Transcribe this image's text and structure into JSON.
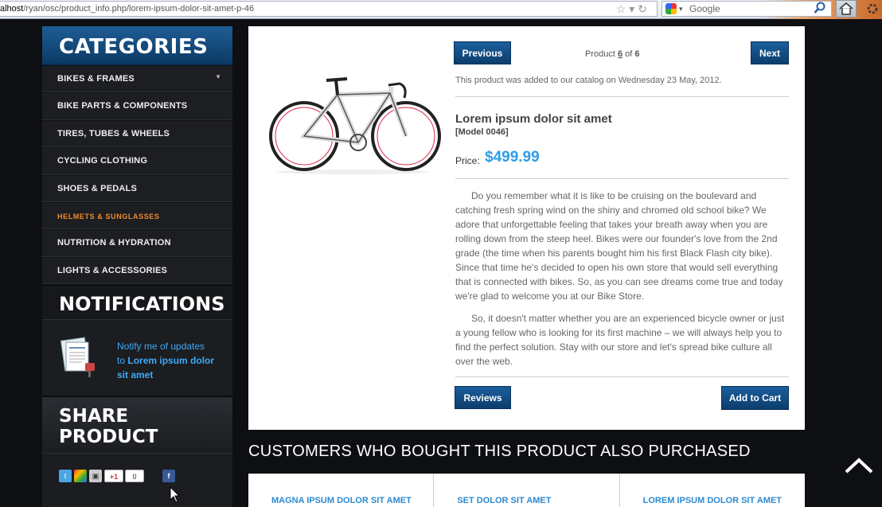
{
  "browser": {
    "url_host": "alhost",
    "url_path": "/ryan/osc/product_info.php/lorem-ipsum-dolor-sit-amet-p-46",
    "search_placeholder": "Google"
  },
  "sidebar": {
    "categories_title": "CATEGORIES",
    "categories": [
      {
        "label": "BIKES & FRAMES"
      },
      {
        "label": "BIKE PARTS & COMPONENTS"
      },
      {
        "label": "TIRES, TUBES & WHEELS"
      },
      {
        "label": "CYCLING CLOTHING"
      },
      {
        "label": "SHOES & PEDALS"
      },
      {
        "label": "HELMETS & SUNGLASSES"
      },
      {
        "label": "NUTRITION & HYDRATION"
      },
      {
        "label": "LIGHTS & ACCESSORIES"
      }
    ],
    "notifications_title": "NOTIFICATIONS",
    "notify_text_1": "Notify me of updates",
    "notify_text_2": "to",
    "notify_product": "Lorem ipsum dolor sit amet",
    "share_title_1": "SHARE",
    "share_title_2": "PRODUCT",
    "share": {
      "gplus": "+1",
      "count": "0"
    }
  },
  "product": {
    "prev_label": "Previous",
    "next_label": "Next",
    "counter_prefix": "Product",
    "counter_current": "6",
    "counter_of": "of",
    "counter_total": "6",
    "added_text": "This product was added to our catalog on Wednesday 23 May, 2012.",
    "name": "Lorem ipsum dolor sit amet",
    "model": "[Model 0046]",
    "price_label": "Price:",
    "price": "$499.99",
    "desc_1": "Do you remember what it is like to be cruising on the boulevard and catching fresh spring wind on the shiny and chromed old school bike? We adore that unforgettable feeling that takes your breath away when you are rolling down from the steep heel. Bikes were our founder's love from the 2nd grade (the time when his parents bought him his first Black Flash city bike). Since that time he's decided to open his own store that would sell everything that is connected with bikes. So, as you can see dreams come true and today we're glad to welcome you at our Bike Store.",
    "desc_2": "So, it doesn't matter whether you are an experienced bicycle owner or just a young fellow who is looking for its first machine – we will always help you to find the perfect solution. Stay with our store and let's spread bike culture all over the web.",
    "reviews_label": "Reviews",
    "cart_label": "Add to Cart"
  },
  "also": {
    "title": "CUSTOMERS WHO BOUGHT THIS PRODUCT ALSO PURCHASED",
    "items": [
      {
        "label": "MAGNA IPSUM DOLOR SIT AMET"
      },
      {
        "label": "SET DOLOR SIT AMET"
      },
      {
        "label": "LOREM IPSUM DOLOR SIT AMET"
      }
    ]
  },
  "colors": {
    "accent": "#2d9ee6",
    "active_category": "#f48a2a",
    "button": "#0c3d6d"
  }
}
